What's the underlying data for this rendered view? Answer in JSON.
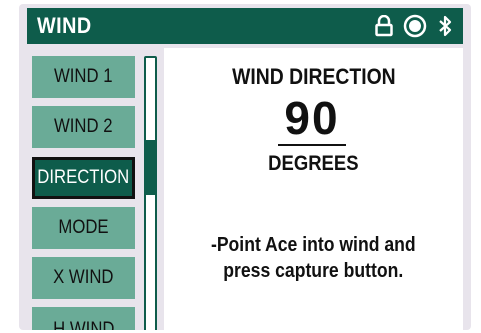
{
  "app": {
    "title": "WIND",
    "status_icons": [
      "lock-icon",
      "record-icon",
      "bluetooth-icon"
    ]
  },
  "menu": {
    "items": [
      {
        "label": "WIND 1",
        "selected": false
      },
      {
        "label": "WIND 2",
        "selected": false
      },
      {
        "label": "DIRECTION",
        "selected": true
      },
      {
        "label": "MODE",
        "selected": false
      },
      {
        "label": "X WIND",
        "selected": false
      },
      {
        "label": "H WIND",
        "selected": false
      }
    ]
  },
  "content": {
    "title": "WIND DIRECTION",
    "value": "90",
    "unit": "DEGREES",
    "instruction_line1": "-Point Ace into wind and",
    "instruction_line2": "press capture button."
  },
  "colors": {
    "primary": "#0e5c4b",
    "button": "#6aab97",
    "frame": "#e8e4ec"
  }
}
